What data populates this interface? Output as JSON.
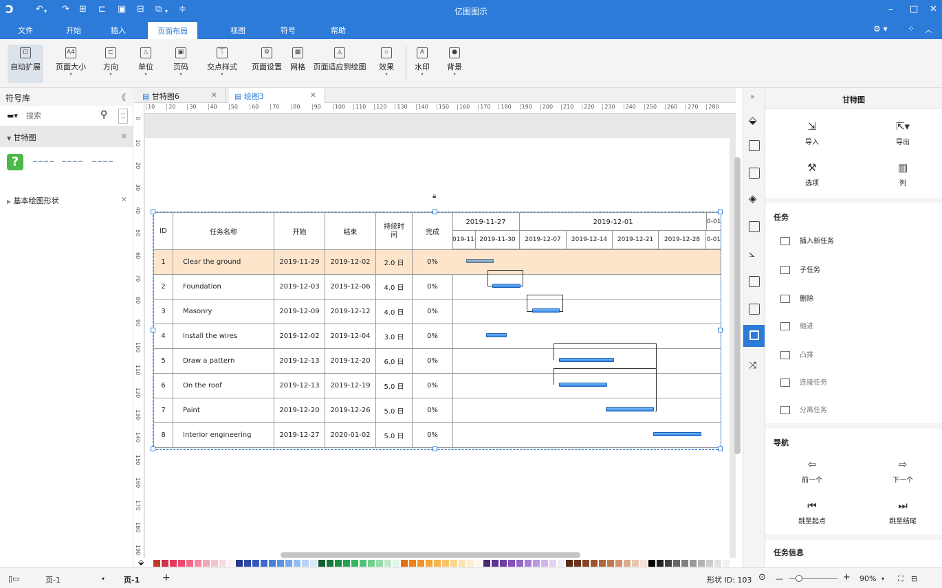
{
  "app": {
    "title": "亿图图示"
  },
  "quick_access": [
    "⟲",
    "⟳",
    "⊞",
    "🗀",
    "🖫",
    "🖶",
    "⧉",
    "⋮"
  ],
  "menu": [
    "文件",
    "开始",
    "插入",
    "页面布局",
    "视图",
    "符号",
    "帮助"
  ],
  "menu_active": "页面布局",
  "ribbon": [
    {
      "label": "自动扩展",
      "icon": "⊡"
    },
    {
      "label": "页面大小",
      "icon": "A4",
      "dropdown": true
    },
    {
      "label": "方向",
      "icon": "⊏",
      "dropdown": true
    },
    {
      "label": "单位",
      "icon": "△",
      "dropdown": true
    },
    {
      "label": "页码",
      "icon": "▣",
      "dropdown": true
    },
    {
      "label": "交点样式",
      "icon": "⏉",
      "dropdown": true
    },
    {
      "label": "页面设置",
      "icon": "⚙"
    },
    {
      "label": "网格",
      "icon": "▦"
    },
    {
      "label": "页面适应到绘图",
      "icon": "◬"
    },
    {
      "label": "效果",
      "icon": "☆",
      "dropdown": true
    },
    {
      "label": "水印",
      "icon": "A",
      "dropdown": true
    },
    {
      "label": "背景",
      "icon": "●",
      "dropdown": true
    }
  ],
  "left_panel": {
    "title": "符号库",
    "search_placeholder": "搜索",
    "section1": "甘特图",
    "section2": "基本绘图形状"
  },
  "tabs": [
    {
      "label": "甘特图6",
      "active": false
    },
    {
      "label": "绘图3",
      "active": true
    }
  ],
  "hruler": [
    "10",
    "20",
    "30",
    "40",
    "50",
    "60",
    "70",
    "80",
    "90",
    "100",
    "110",
    "120",
    "130",
    "140",
    "150",
    "160",
    "170",
    "180",
    "190",
    "200",
    "210",
    "220",
    "230",
    "240",
    "250",
    "260",
    "270",
    "280"
  ],
  "vruler": [
    "0",
    "10",
    "20",
    "30",
    "40",
    "50",
    "60",
    "70",
    "80",
    "90",
    "100",
    "110",
    "120",
    "130",
    "140",
    "150",
    "160",
    "170",
    "180",
    "190"
  ],
  "gantt": {
    "headers": [
      "ID",
      "任务名称",
      "开始",
      "结束",
      "持续时间",
      "完成"
    ],
    "months": [
      "2019-11-27",
      "2019-12-01",
      "0-01"
    ],
    "weeks": [
      "019-11-2",
      "2019-11-30",
      "2019-12-07",
      "2019-12-14",
      "2019-12-21",
      "2019-12-28",
      "0-01"
    ],
    "rows": [
      {
        "id": "1",
        "name": "Clear the ground",
        "start": "2019-11-29",
        "end": "2019-12-02",
        "duration": "2.0 日",
        "done": "0%"
      },
      {
        "id": "2",
        "name": "Foundation",
        "start": "2019-12-03",
        "end": "2019-12-06",
        "duration": "4.0 日",
        "done": "0%"
      },
      {
        "id": "3",
        "name": "Masonry",
        "start": "2019-12-09",
        "end": "2019-12-12",
        "duration": "4.0 日",
        "done": "0%"
      },
      {
        "id": "4",
        "name": "Install the wires",
        "start": "2019-12-02",
        "end": "2019-12-04",
        "duration": "3.0 日",
        "done": "0%"
      },
      {
        "id": "5",
        "name": "Draw a pattern",
        "start": "2019-12-13",
        "end": "2019-12-20",
        "duration": "6.0 日",
        "done": "0%"
      },
      {
        "id": "6",
        "name": "On the roof",
        "start": "2019-12-13",
        "end": "2019-12-19",
        "duration": "5.0 日",
        "done": "0%"
      },
      {
        "id": "7",
        "name": "Paint",
        "start": "2019-12-20",
        "end": "2019-12-26",
        "duration": "5.0 日",
        "done": "0%"
      },
      {
        "id": "8",
        "name": "Interior engineering",
        "start": "2019-12-27",
        "end": "2020-01-02",
        "duration": "5.0 日",
        "done": "0%"
      }
    ]
  },
  "right_panel": {
    "title": "甘特图",
    "import": "导入",
    "export": "导出",
    "options": "选项",
    "columns": "列",
    "task_section": "任务",
    "task_items": [
      "插入新任务",
      "子任务",
      "删除",
      "缩进",
      "凸排",
      "连接任务",
      "分离任务"
    ],
    "nav_section": "导航",
    "prev": "前一个",
    "next": "下一个",
    "to_start": "跳至起点",
    "to_end": "跳至结尾",
    "info_section": "任务信息"
  },
  "status": {
    "page_dropdown": "页-1",
    "page_tab": "页-1",
    "add": "+",
    "shape_id": "形状 ID: 103",
    "zoom": "90%"
  },
  "colors": {
    "accent": "#2d7bd8",
    "bar": "#2f86e6",
    "highlight_row": "#fde5cc"
  }
}
